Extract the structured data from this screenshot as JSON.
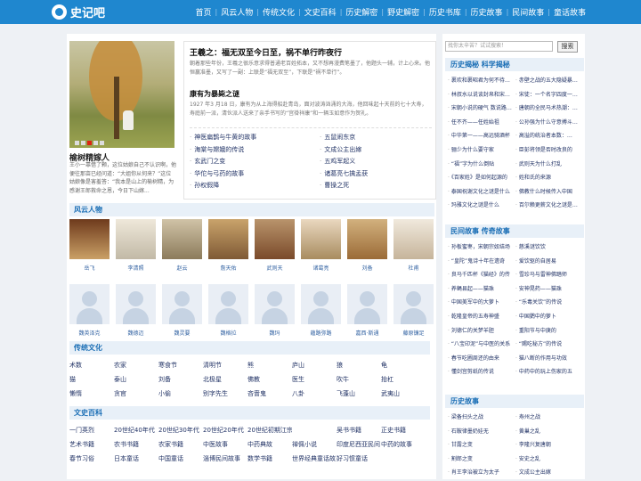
{
  "site": {
    "logo_text": "史记吧"
  },
  "nav": [
    "首页",
    "风云人物",
    "传统文化",
    "文史百科",
    "历史解密",
    "野史解密",
    "历史书库",
    "历史故事",
    "民间故事",
    "童话故事"
  ],
  "featured": {
    "title": "榆树精嫁人",
    "desc": "王小一靠借了颗，这位姑娘自己不认识啊，他便往那亩已经问道：“大姐你从何来？”这位姑娘像是害羞答：“我本是山上的榆树精，为感谢王郎救命之恩，今日下山嫁..."
  },
  "headline": {
    "title": "王羲之：福无双至今日至，祸不单行昨夜行",
    "desc": "朝着那些年份，王羲之很乐意求得普通老百姓拓本，又不想再漫费笔墨了，他题头一辅，计上心来。他恒赢准墨，又写了一副：上联是“福无双至”，下联是“祸不单行”。",
    "sub_title": "康有为暴毙之谜",
    "sub_desc": "1927 年3 月18 日，康有为从上海得船赴青岛，面对波涛汹涌的大海，他回味起十天前的七十大寿，寿庭前一派，清伙派人送来了亲手书写的“宫褂祥康”和一辆玉如意作为贺礼。",
    "links": [
      "神医扁鹊与牛黄的故事",
      "五鼠闹东京",
      "海棠与嫦娥的传说",
      "文成公主出嫁",
      "玄武门之变",
      "五鸡军起义",
      "华佗与弓药的故事",
      "诸葛亮七擒孟获",
      "孙权假降",
      "曹操之死"
    ]
  },
  "people_section": {
    "title": "风云人物"
  },
  "people": [
    {
      "name": "岳飞",
      "photo": "p0"
    },
    {
      "name": "李清照",
      "photo": "p1"
    },
    {
      "name": "赵云",
      "photo": "p2"
    },
    {
      "name": "詹天佑",
      "photo": "p3"
    },
    {
      "name": "武则天",
      "photo": "p4"
    },
    {
      "name": "诸葛亮",
      "photo": "p5"
    },
    {
      "name": "刘备",
      "photo": "p6"
    },
    {
      "name": "杜甫",
      "photo": "p7"
    },
    {
      "name": "魏英泽克",
      "photo": "blank"
    },
    {
      "name": "魏德迈",
      "photo": "blank"
    },
    {
      "name": "魏灵要",
      "photo": "blank"
    },
    {
      "name": "魏格拉",
      "photo": "blank"
    },
    {
      "name": "魏玛",
      "photo": "blank"
    },
    {
      "name": "蘊路弥路",
      "photo": "blank"
    },
    {
      "name": "嘉西·斯通",
      "photo": "blank"
    },
    {
      "name": "藤原镰足",
      "photo": "blank"
    }
  ],
  "culture": {
    "title": "传统文化",
    "items": [
      "术数",
      "农家",
      "寒食节",
      "清明节",
      "熊",
      "庐山",
      "狼",
      "龟",
      "猫",
      "泰山",
      "刘备",
      "北极星",
      "佛教",
      "医生",
      "吹牛",
      "抬杠",
      "懒惰",
      "贪官",
      "小偷",
      "别字先生",
      "吝啬鬼",
      "八卦",
      "飞蓬山",
      "武夷山"
    ]
  },
  "encyclopedia": {
    "title": "文史百科",
    "items": [
      "一门英烈",
      "20世纪40年代",
      "20世纪30年代",
      "20世纪20年代",
      "20世纪初期江宗小说书籍",
      "",
      "吴书书籍",
      "正史书籍",
      "艺术书籍",
      "农书书籍",
      "农家书籍",
      "中医故事",
      "中药典故",
      "禅佩小说",
      "印度尼西亚民间",
      "中药的故事",
      "春节习俗",
      "日本童话",
      "中国童话",
      "淄博民间故事",
      "数学书籍",
      "世界经典童话故事",
      "好习惯童话",
      ""
    ]
  },
  "sidebar": {
    "search_placeholder": "找你太辛苦？试试搜索！",
    "search_button": "搜索",
    "section1_title": "历史揭秘 科学揭秘",
    "section1_items": [
      "裹欢和裹昭君为何不待…",
      "赤壁之战的五大隐疑暴…",
      "林叔水以说谈封帛和宋…",
      "宋徒：一个名字四度一…",
      "宋朝小说的硬气 数说路…",
      "唐朝的全民马术热潮：…",
      "任不齐——任姓始祖",
      "公孙强为什么守意搏斗…",
      "中华第一——高远骑酒杯",
      "高溢的统治者本数：…",
      "骊少为什么要守家",
      "臣彭将领是否时改良的",
      "“福”字为什么倒贴",
      "武则天为什么打乱",
      "《百家姓》是如何起源的",
      "姓和氏的来源",
      "泰国祝谢文化之谜是什么",
      "佛教什么时候传入中国",
      "玛雅文化之谜是什么",
      "百尔赖更薪文化之谜是…"
    ],
    "section2_title": "民间故事 传奇故事",
    "section2_items": [
      "孙板蜜枣，宋朝宗奴结场",
      "慈溪谜饮饮",
      "“皇陀”鬼诗十年在遗奇",
      "爱饮驱的自居易",
      "良马千匹杯《猫经》的传",
      "雪珍马与雷神佛踏师",
      "养蝇县起——猫珠",
      "安神晃药——猫珠",
      "中国美军中的大萝卜",
      "“乐毒关饮”的传说",
      "乾隆皇帝的五寿神盛",
      "中国鹦中的萝卜",
      "刘德仁的关梦羊胆",
      "重阳节与中庚的",
      "“八宝印泥”与中医的关系",
      "“赐吃秘方”的传说",
      "春节吃圃周还的由来",
      "猫八断的作用与功效",
      "懂剑宫剪纸的传说",
      "中药中的玩上伤家的五"
    ],
    "section3_title": "历史故事",
    "section3_items": [
      "梁备扫头之战",
      "寿州之战",
      "石鞍律墨奶娃无",
      "黄巢之乱",
      "甘露之变",
      "李隆兴复唐朝",
      "割郎之变",
      "安史之乱",
      "肖王李治被立为太子",
      "文成公主出嫁"
    ]
  }
}
